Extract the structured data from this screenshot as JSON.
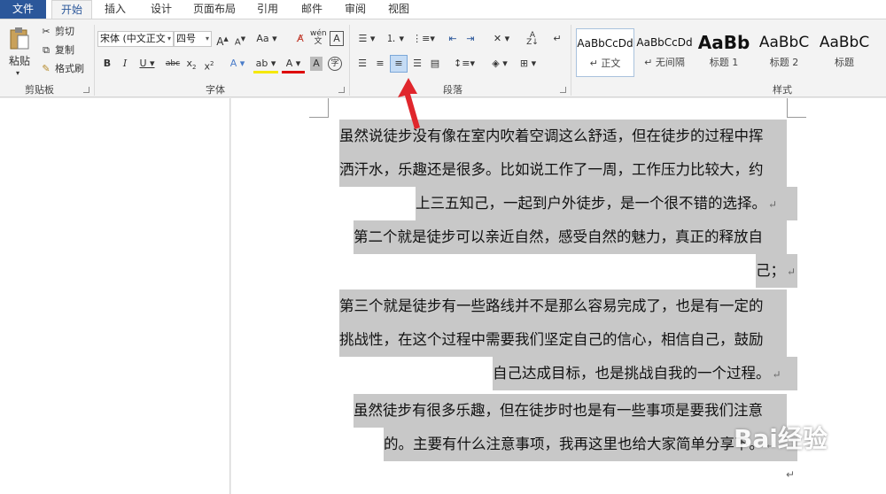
{
  "tabs": [
    "文件",
    "开始",
    "插入",
    "设计",
    "页面布局",
    "引用",
    "邮件",
    "审阅",
    "视图"
  ],
  "clipboard": {
    "paste": "粘贴",
    "cut": "剪切",
    "copy": "复制",
    "painter": "格式刷",
    "group": "剪贴板"
  },
  "font": {
    "name": "宋体 (中文正文",
    "size": "四号",
    "group": "字体"
  },
  "paragraph": {
    "group": "段落"
  },
  "styles": {
    "group": "样式",
    "items": [
      {
        "preview": "AaBbCcDd",
        "name": "↵ 正文"
      },
      {
        "preview": "AaBbCcDd",
        "name": "↵ 无间隔"
      },
      {
        "preview": "AaBb",
        "name": "标题 1"
      },
      {
        "preview": "AaBbC",
        "name": "标题 2"
      },
      {
        "preview": "AaBbC",
        "name": "标题"
      }
    ]
  },
  "doc": {
    "lines": [
      "虽然说徒步没有像在室内吹着空调这么舒适，但在徒步的过程中挥",
      "洒汗水，乐趣还是很多。比如说工作了一周，工作压力比较大，约",
      "上三五知己，一起到户外徒步，是一个很不错的选择。",
      "第二个就是徒步可以亲近自然，感受自然的魅力，真正的释放自",
      "己；",
      "第三个就是徒步有一些路线并不是那么容易完成了，也是有一定的",
      "挑战性，在这个过程中需要我们坚定自己的信心，相信自己，鼓励",
      "自己达成目标，也是挑战自我的一个过程。",
      "虽然徒步有很多乐趣，但在徒步时也是有一些事项是要我们注意",
      "的。主要有什么注意事项，我再这里也给大家简单分享下。"
    ],
    "paragraph_mark": "↵"
  },
  "watermark": "Bai经验"
}
